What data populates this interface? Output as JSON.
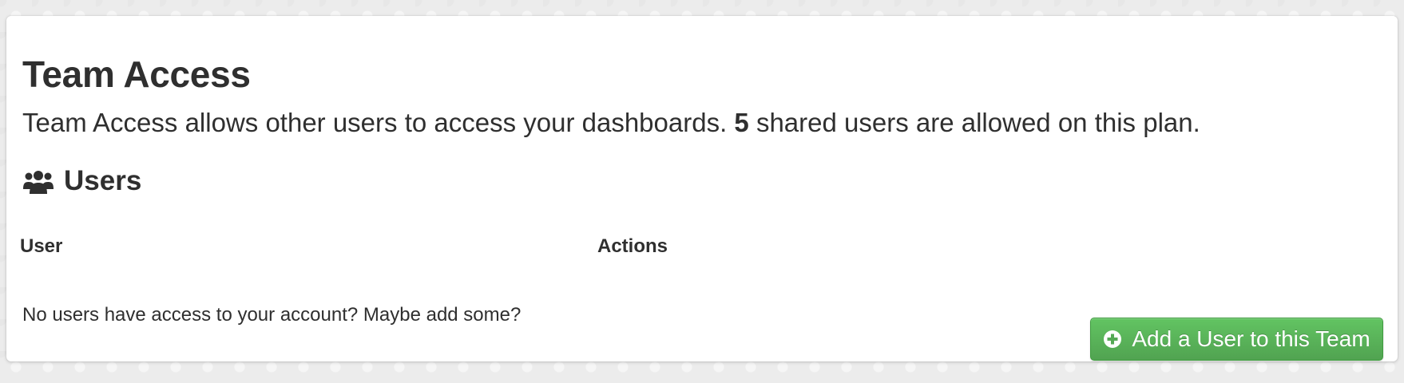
{
  "page": {
    "title": "Team Access",
    "description_before": "Team Access allows other users to access your dashboards. ",
    "shared_users_allowed": "5",
    "description_after": " shared users are allowed on this plan."
  },
  "users_section": {
    "icon": "users-icon",
    "title": "Users",
    "columns": [
      "User",
      "Actions"
    ],
    "empty_message": "No users have access to your account? Maybe add some?"
  },
  "add_user_button": {
    "icon": "plus-circle-icon",
    "label": "Add a User to this Team",
    "color": "#5bb75b"
  }
}
